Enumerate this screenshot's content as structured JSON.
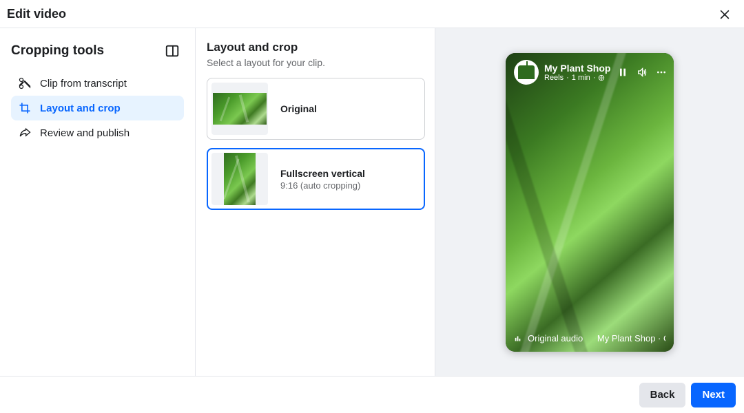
{
  "header": {
    "title": "Edit video"
  },
  "sidebar": {
    "title": "Cropping tools",
    "items": [
      {
        "label": "Clip from transcript"
      },
      {
        "label": "Layout and crop"
      },
      {
        "label": "Review and publish"
      }
    ]
  },
  "main": {
    "title": "Layout and crop",
    "subtitle": "Select a layout for your clip.",
    "options": [
      {
        "title": "Original",
        "subtitle": ""
      },
      {
        "title": "Fullscreen vertical",
        "subtitle": "9:16 (auto cropping)"
      }
    ]
  },
  "preview": {
    "page_name": "My Plant Shop",
    "meta_type": "Reels",
    "meta_time": "1 min",
    "audio_label": "Original audio",
    "audio_attr": "My Plant Shop · O"
  },
  "footer": {
    "back": "Back",
    "next": "Next"
  }
}
